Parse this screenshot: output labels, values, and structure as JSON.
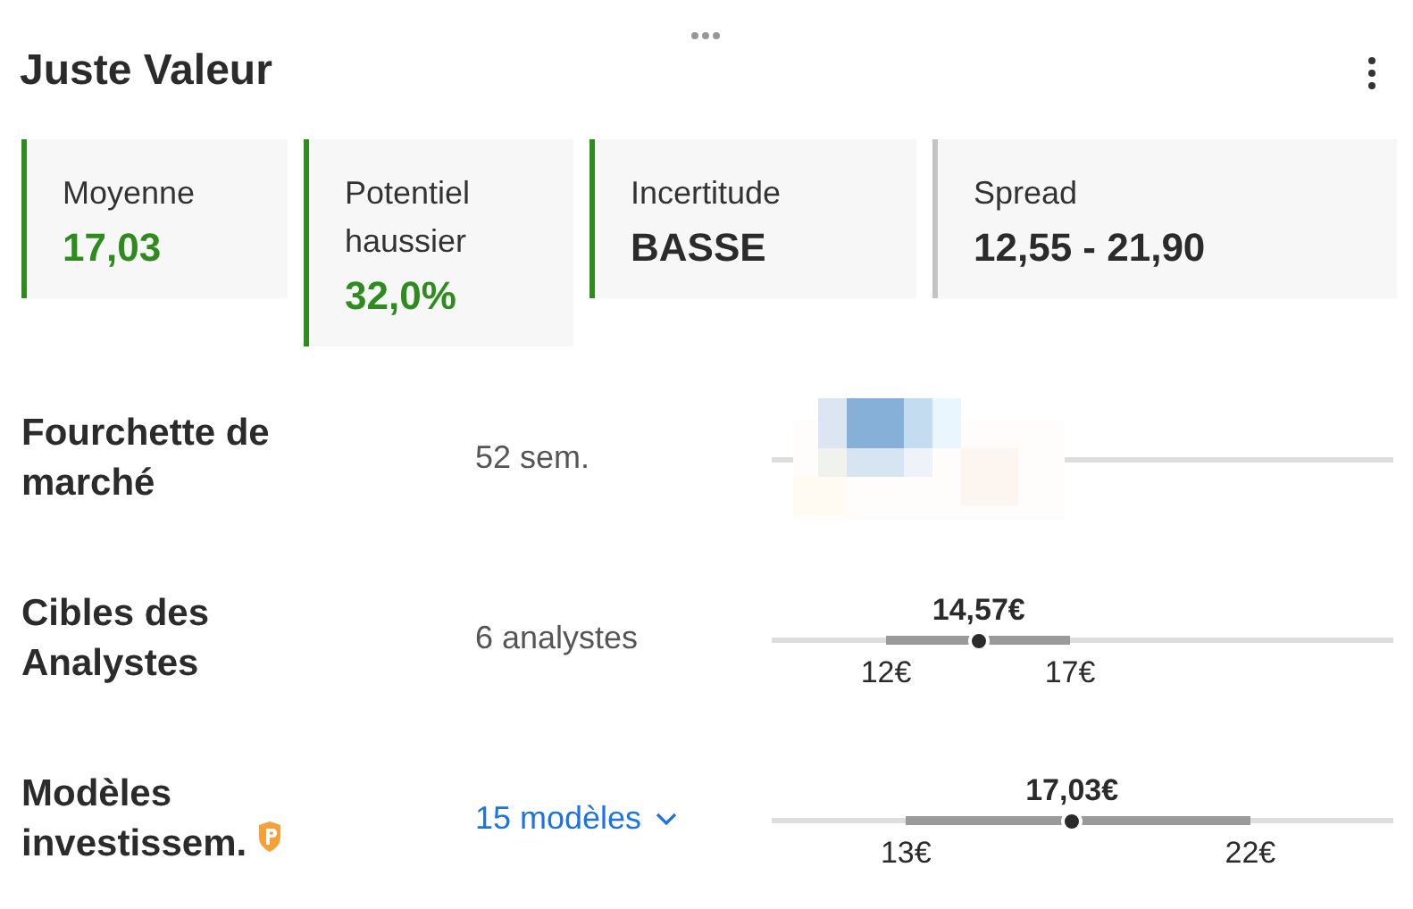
{
  "header": {
    "title": "Juste Valeur"
  },
  "cards": [
    {
      "label": "Moyenne",
      "value": "17,03",
      "kind": "positive",
      "color": "#2e8b1e"
    },
    {
      "label": "Potentiel haussier",
      "value": "32,0%",
      "kind": "positive",
      "color": "#2e8b1e"
    },
    {
      "label": "Incertitude",
      "value": "BASSE",
      "kind": "neutral",
      "color": "#2e8b1e"
    },
    {
      "label": "Spread",
      "value": "12,55 - 21,90",
      "kind": "neutral",
      "color": "#c4c4c4"
    }
  ],
  "rows": [
    {
      "label": "Fourchette de marché",
      "detail": {
        "kind": "text",
        "text": "52 sem."
      }
    },
    {
      "label": "Cibles des Analystes",
      "detail": {
        "kind": "text",
        "text": "6 analystes"
      },
      "chart": {
        "kind": "range",
        "value_label": "14,57€",
        "low_label": "12€",
        "high_label": "17€",
        "marker": {
          "level": 0.333
        }
      }
    },
    {
      "label": "Modèles investissem.",
      "premium": true,
      "detail": {
        "kind": "toggle",
        "text": "15 modèles",
        "expanded": false
      },
      "chart": {
        "kind": "range",
        "value_label": "17,03€",
        "low_label": "13€",
        "high_label": "22€",
        "marker": {
          "level": 0.483
        }
      }
    }
  ]
}
